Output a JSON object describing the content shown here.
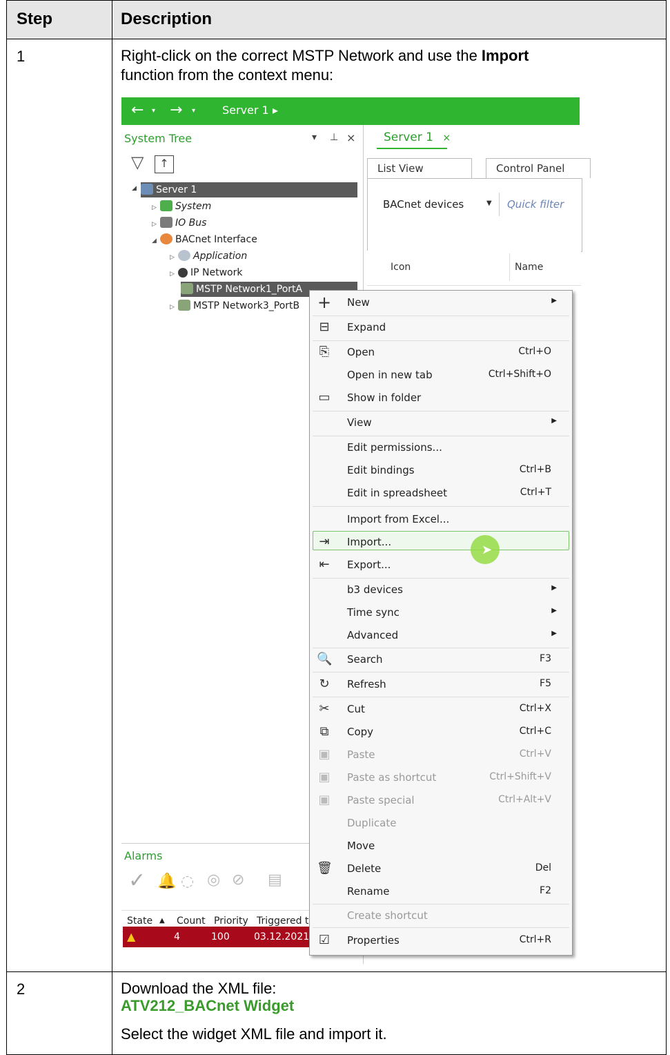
{
  "table": {
    "header": {
      "step": "Step",
      "description": "Description"
    },
    "rows": [
      {
        "step": "1",
        "text_before": "Right-click on the correct MSTP Network and use the ",
        "text_bold": "Import",
        "text_after": "function from the context menu:"
      },
      {
        "step": "2",
        "text": "Download the XML file:",
        "link": "ATV212_BACnet Widget",
        "text2": "Select the widget XML file and import it."
      }
    ]
  },
  "screenshot": {
    "breadcrumb": "Server 1 ▸",
    "system_tree": {
      "title": "System Tree",
      "items": [
        {
          "label": "Server 1"
        },
        {
          "label": "System"
        },
        {
          "label": "IO Bus"
        },
        {
          "label": "BACnet Interface"
        },
        {
          "label": "Application"
        },
        {
          "label": "IP Network"
        },
        {
          "label": "MSTP Network1_PortA"
        },
        {
          "label": "MSTP Network3_PortB"
        }
      ]
    },
    "document_tab": {
      "label": "Server 1",
      "close": "×"
    },
    "subtabs": [
      "List View",
      "Control Panel"
    ],
    "filter": {
      "dropdown": "BACnet devices",
      "placeholder": "Quick filter"
    },
    "grid_columns": [
      "Icon",
      "Name"
    ],
    "alarms": {
      "title": "Alarms",
      "columns": [
        "State",
        "Count",
        "Priority",
        "Triggered t"
      ],
      "row": {
        "count": "4",
        "priority": "100",
        "triggered": "03.12.2021"
      }
    },
    "context_menu": [
      {
        "label": "New",
        "shortcut": "",
        "submenu": true,
        "icon": "plus-icon"
      },
      {
        "label": "Expand",
        "shortcut": "",
        "icon": "expand-icon"
      },
      {
        "label": "Open",
        "shortcut": "Ctrl+O",
        "icon": "open-icon"
      },
      {
        "label": "Open in new tab",
        "shortcut": "Ctrl+Shift+O"
      },
      {
        "label": "Show in folder",
        "shortcut": "",
        "icon": "folder-icon"
      },
      {
        "label": "View",
        "shortcut": "",
        "submenu": true
      },
      {
        "label": "Edit permissions...",
        "shortcut": ""
      },
      {
        "label": "Edit bindings",
        "shortcut": "Ctrl+B"
      },
      {
        "label": "Edit in spreadsheet",
        "shortcut": "Ctrl+T"
      },
      {
        "label": "Import from Excel...",
        "shortcut": ""
      },
      {
        "label": "Import...",
        "shortcut": "",
        "icon": "import-icon",
        "highlighted": true
      },
      {
        "label": "Export...",
        "shortcut": "",
        "icon": "export-icon"
      },
      {
        "label": "b3 devices",
        "shortcut": "",
        "submenu": true
      },
      {
        "label": "Time sync",
        "shortcut": "",
        "submenu": true
      },
      {
        "label": "Advanced",
        "shortcut": "",
        "submenu": true
      },
      {
        "label": "Search",
        "shortcut": "F3",
        "icon": "search-icon"
      },
      {
        "label": "Refresh",
        "shortcut": "F5",
        "icon": "refresh-icon"
      },
      {
        "label": "Cut",
        "shortcut": "Ctrl+X",
        "icon": "cut-icon"
      },
      {
        "label": "Copy",
        "shortcut": "Ctrl+C",
        "icon": "copy-icon"
      },
      {
        "label": "Paste",
        "shortcut": "Ctrl+V",
        "disabled": true,
        "icon": "paste-icon"
      },
      {
        "label": "Paste as shortcut",
        "shortcut": "Ctrl+Shift+V",
        "disabled": true,
        "icon": "paste-icon"
      },
      {
        "label": "Paste special",
        "shortcut": "Ctrl+Alt+V",
        "disabled": true,
        "icon": "paste-icon"
      },
      {
        "label": "Duplicate",
        "shortcut": "",
        "disabled": true
      },
      {
        "label": "Move",
        "shortcut": ""
      },
      {
        "label": "Delete",
        "shortcut": "Del",
        "icon": "delete-icon"
      },
      {
        "label": "Rename",
        "shortcut": "F2"
      },
      {
        "label": "Create shortcut",
        "shortcut": "",
        "disabled": true
      },
      {
        "label": "Properties",
        "shortcut": "Ctrl+R",
        "icon": "properties-icon"
      }
    ]
  },
  "colors": {
    "accent_green": "#2fb530",
    "link_green": "#3a9b2c",
    "alarm_red": "#a8091b",
    "header_gray": "#e6e6e6"
  }
}
